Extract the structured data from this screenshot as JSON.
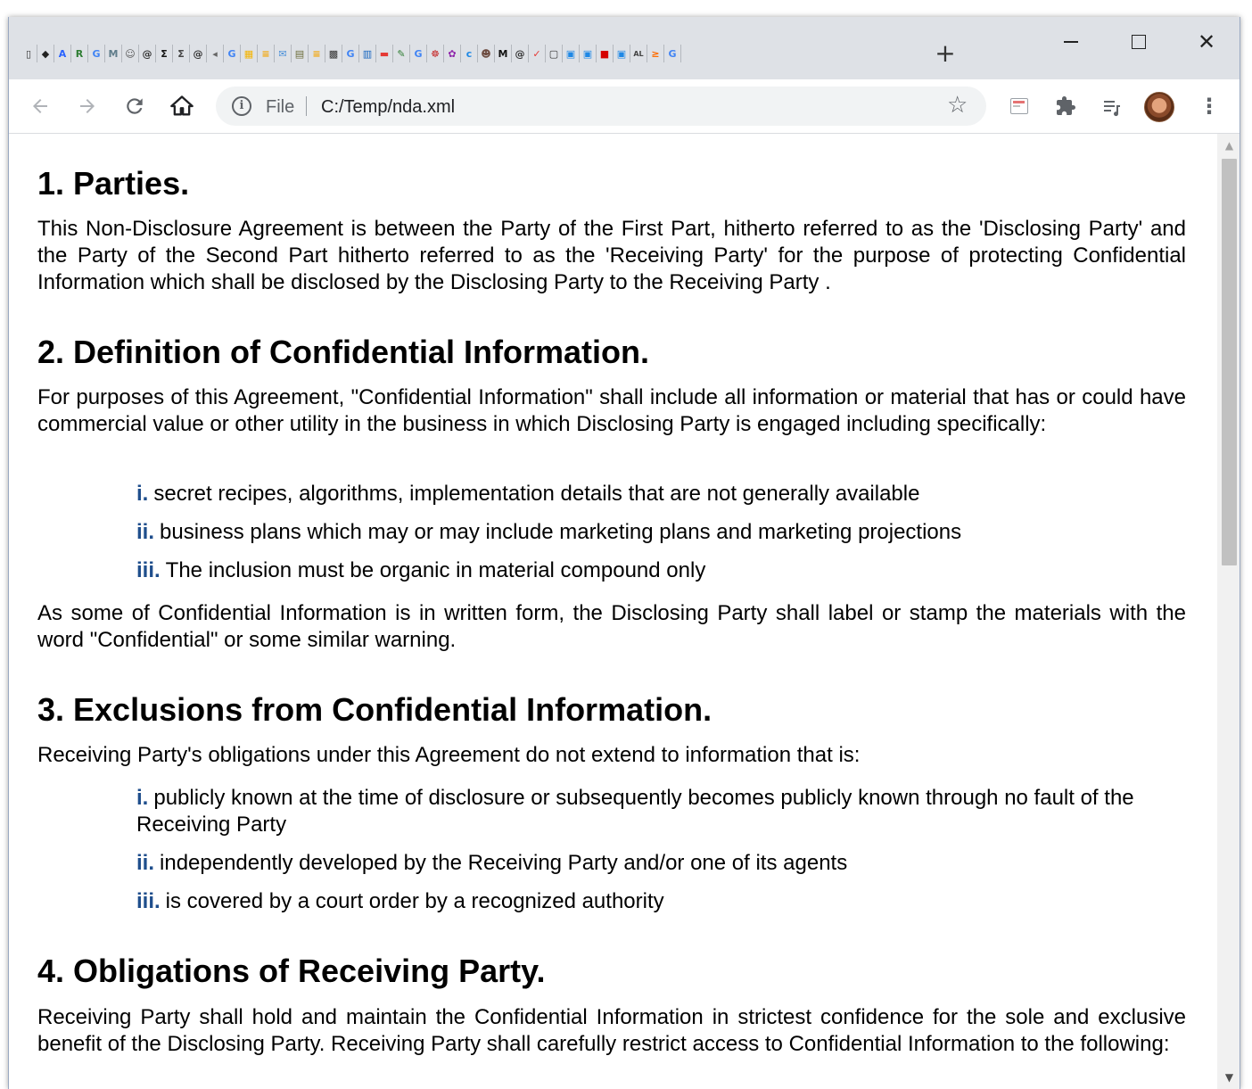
{
  "browser": {
    "tab_favicons": [
      {
        "icon": "bookmark-icon",
        "glyph": "▯",
        "color": "#333333"
      },
      {
        "icon": "shield-icon",
        "glyph": "◆",
        "color": "#222222"
      },
      {
        "icon": "a-icon",
        "glyph": "A",
        "color": "#2962ff"
      },
      {
        "icon": "r-icon",
        "glyph": "R",
        "color": "#2e7d32"
      },
      {
        "icon": "g-icon",
        "glyph": "G",
        "color": "#4285f4"
      },
      {
        "icon": "m-icon",
        "glyph": "M",
        "color": "#607d8b"
      },
      {
        "icon": "face-icon",
        "glyph": "☺",
        "color": "#555555"
      },
      {
        "icon": "swirl-icon",
        "glyph": "@",
        "color": "#333333"
      },
      {
        "icon": "sigma-icon",
        "glyph": "Σ",
        "color": "#111111"
      },
      {
        "icon": "sigma-outline-icon",
        "glyph": "Σ",
        "color": "#444444"
      },
      {
        "icon": "swirl-icon",
        "glyph": "@",
        "color": "#333333"
      },
      {
        "icon": "speaker-icon",
        "glyph": "◂",
        "color": "#666666"
      },
      {
        "icon": "g-icon",
        "glyph": "G",
        "color": "#4285f4"
      },
      {
        "icon": "grid-icon",
        "glyph": "▦",
        "color": "#f4b400"
      },
      {
        "icon": "stack-icon",
        "glyph": "≡",
        "color": "#f4a300"
      },
      {
        "icon": "mail-icon",
        "glyph": "✉",
        "color": "#4a90d9"
      },
      {
        "icon": "doc-icon",
        "glyph": "▤",
        "color": "#6d6d3b"
      },
      {
        "icon": "stack-icon",
        "glyph": "≡",
        "color": "#f4a300"
      },
      {
        "icon": "qr-icon",
        "glyph": "▩",
        "color": "#333333"
      },
      {
        "icon": "g-icon",
        "glyph": "G",
        "color": "#4285f4"
      },
      {
        "icon": "list-icon",
        "glyph": "▥",
        "color": "#1565c0"
      },
      {
        "icon": "youtube-icon",
        "glyph": "▬",
        "color": "#e53935"
      },
      {
        "icon": "pen-icon",
        "glyph": "✎",
        "color": "#2e7d32"
      },
      {
        "icon": "g-icon",
        "glyph": "G",
        "color": "#4285f4"
      },
      {
        "icon": "red-icon",
        "glyph": "☸",
        "color": "#c62828"
      },
      {
        "icon": "color-icon",
        "glyph": "✿",
        "color": "#8e24aa"
      },
      {
        "icon": "c-icon",
        "glyph": "c",
        "color": "#1e88e5"
      },
      {
        "icon": "face-icon",
        "glyph": "☻",
        "color": "#6d4c41"
      },
      {
        "icon": "m-icon",
        "glyph": "M",
        "color": "#111111"
      },
      {
        "icon": "swirl-icon",
        "glyph": "@",
        "color": "#333333"
      },
      {
        "icon": "pocket-icon",
        "glyph": "✓",
        "color": "#e53935"
      },
      {
        "icon": "page-icon",
        "glyph": "▢",
        "color": "#333333"
      },
      {
        "icon": "box-icon",
        "glyph": "▣",
        "color": "#1e88e5"
      },
      {
        "icon": "box-icon",
        "glyph": "▣",
        "color": "#1e88e5"
      },
      {
        "icon": "red-box-icon",
        "glyph": "■",
        "color": "#d50000"
      },
      {
        "icon": "box-icon",
        "glyph": "▣",
        "color": "#1e88e5"
      },
      {
        "icon": "al-icon",
        "glyph": "AL",
        "color": "#444444"
      },
      {
        "icon": "sum-icon",
        "glyph": "≥",
        "color": "#ff6d00"
      },
      {
        "icon": "g-icon",
        "glyph": "G",
        "color": "#4285f4"
      }
    ],
    "new_tab_label": "+",
    "window_close": "✕",
    "omnibox": {
      "info": "i",
      "scheme": "File",
      "url": "C:/Temp/nda.xml"
    }
  },
  "document": {
    "sections": [
      {
        "heading": "1. Parties.",
        "paragraphs": [
          "This Non-Disclosure Agreement is between the Party of the First Part, hitherto referred to as the 'Disclosing Party' and the Party of the Second Part hitherto referred to as the 'Receiving Party' for the purpose of protecting Confidential Information which shall be disclosed by the Disclosing Party to the Receiving Party ."
        ]
      },
      {
        "heading": "2. Definition of Confidential Information.",
        "paragraphs": [
          "For purposes of this Agreement, \"Confidential Information\" shall include all information or material that has or could have commercial value or other utility in the business in which Disclosing Party is engaged including specifically:",
          "As some of Confidential Information is in written form, the Disclosing Party shall label or stamp the materials with the word \"Confidential\" or some similar warning."
        ],
        "items": [
          {
            "num": "i.",
            "text": "secret recipes, algorithms, implementation details that are not generally available"
          },
          {
            "num": "ii.",
            "text": "business plans which may or may include marketing plans and marketing projections"
          },
          {
            "num": "iii.",
            "text": "The inclusion must be organic in material compound only"
          }
        ]
      },
      {
        "heading": "3. Exclusions from Confidential Information.",
        "paragraphs": [
          "Receiving Party's obligations under this Agreement do not extend to information that is:"
        ],
        "items": [
          {
            "num": "i.",
            "text": "publicly known at the time of disclosure or subsequently becomes publicly known through no fault of the Receiving Party"
          },
          {
            "num": "ii.",
            "text": "independently developed by the Receiving Party and/or one of its agents"
          },
          {
            "num": "iii.",
            "text": "is covered by a court order by a recognized authority"
          }
        ]
      },
      {
        "heading": "4. Obligations of Receiving Party.",
        "paragraphs": [
          "Receiving Party shall hold and maintain the Confidential Information in strictest confidence for the sole and exclusive benefit of the Disclosing Party. Receiving Party shall carefully restrict access to Confidential Information to the following:"
        ]
      }
    ]
  }
}
